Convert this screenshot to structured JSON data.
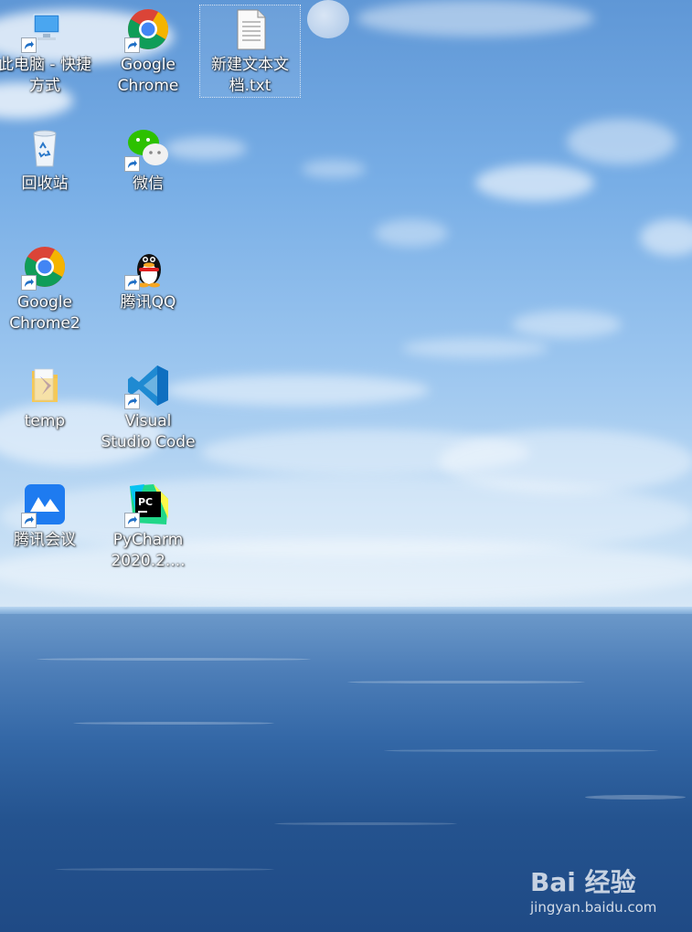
{
  "desktop": {
    "icons": [
      {
        "label": "此电脑 - 快捷\n方式",
        "icon": "computer-icon"
      },
      {
        "label": "Google\nChrome",
        "icon": "chrome-icon"
      },
      {
        "label": "新建文本文\n档.txt",
        "icon": "text-file-icon"
      },
      {
        "label": "回收站",
        "icon": "recycle-bin-icon"
      },
      {
        "label": "微信",
        "icon": "wechat-icon"
      },
      {
        "label": "Google\nChrome2",
        "icon": "chrome-icon"
      },
      {
        "label": "腾讯QQ",
        "icon": "qq-penguin-icon"
      },
      {
        "label": "temp",
        "icon": "folder-icon"
      },
      {
        "label": "Visual\nStudio Code",
        "icon": "vscode-icon"
      },
      {
        "label": "腾讯会议",
        "icon": "tencent-meeting-icon"
      },
      {
        "label": "PyCharm\n2020.2....",
        "icon": "pycharm-icon"
      }
    ]
  },
  "watermark": {
    "brand": "Bai 经验",
    "url": "jingyan.baidu.com"
  }
}
